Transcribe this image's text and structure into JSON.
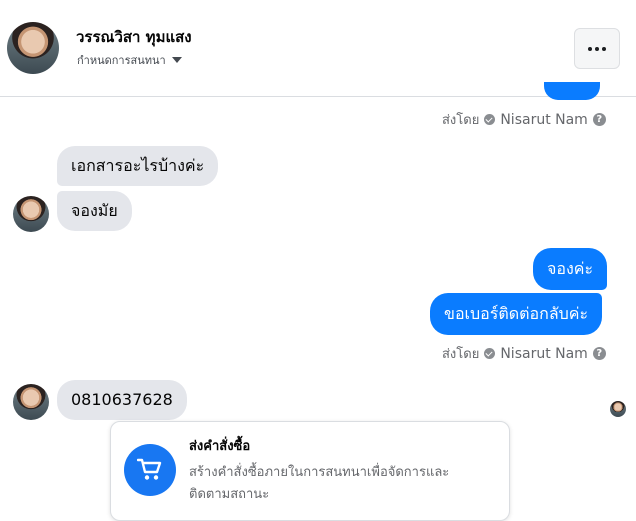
{
  "header": {
    "name": "วรรณวิสา ทุมแสง",
    "subtitle": "กำหนดการสนทนา"
  },
  "sent_by": {
    "prefix": "ส่งโดย",
    "name": "Nisarut Nam",
    "help": "?"
  },
  "messages": {
    "in_1": "เอกสารอะไรบ้างค่ะ",
    "in_2": "จองมัย",
    "out_1": "จองค่ะ",
    "out_2": "ขอเบอร์ติดต่อกลับค่ะ",
    "in_3": "0810637628"
  },
  "card": {
    "title": "ส่งคำสั่งซื้อ",
    "description": "สร้างคำสั่งซื้อภายในการสนทนาเพื่อจัดการและติดตามสถานะ"
  },
  "colors": {
    "accent": "#0a7cff",
    "incoming_bubble": "#e4e6eb",
    "card_icon": "#1877f2"
  },
  "icons": {
    "more": "more-horizontal-icon",
    "dropdown": "chevron-down-icon",
    "verified": "check-circle-icon",
    "help": "question-circle-icon",
    "cart": "cart-icon"
  }
}
